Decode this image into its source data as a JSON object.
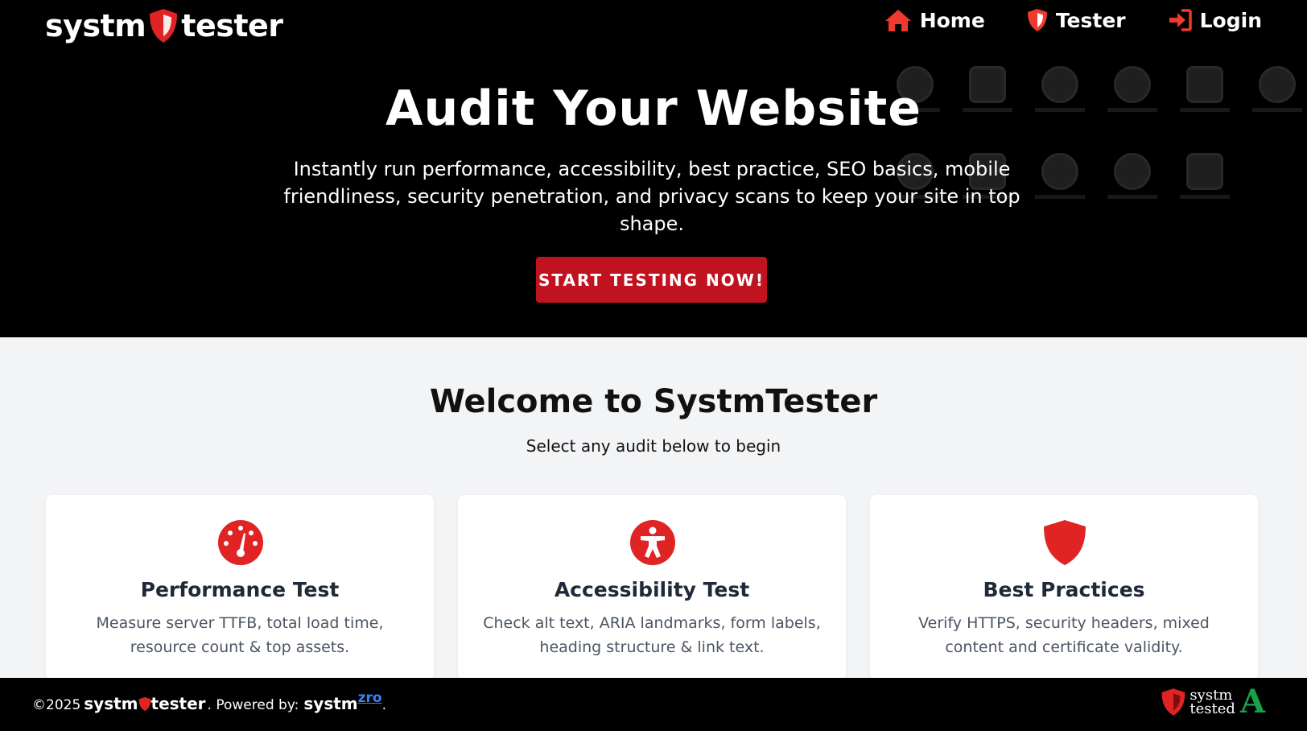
{
  "brand": {
    "word1": "systm",
    "word2": "tester",
    "accent": "#e02424"
  },
  "nav": [
    {
      "label": "Home",
      "icon": "home-icon"
    },
    {
      "label": "Tester",
      "icon": "shield-icon"
    },
    {
      "label": "Login",
      "icon": "login-icon"
    }
  ],
  "hero": {
    "title": "Audit Your Website",
    "subtitle": "Instantly run performance, accessibility, best practice, SEO basics, mobile friendliness, security penetration, and privacy scans to keep your site in top shape.",
    "cta": "START TESTING NOW!"
  },
  "welcome": {
    "title": "Welcome to SystmTester",
    "subtitle": "Select any audit below to begin"
  },
  "cards": [
    {
      "title": "Performance Test",
      "desc": "Measure server TTFB, total load time, resource count & top assets.",
      "icon": "gauge-icon"
    },
    {
      "title": "Accessibility Test",
      "desc": "Check alt text, ARIA landmarks, form labels, heading structure & link text.",
      "icon": "accessibility-icon"
    },
    {
      "title": "Best Practices",
      "desc": "Verify HTTPS, security headers, mixed content and certificate validity.",
      "icon": "shield-icon"
    }
  ],
  "footer": {
    "copyright": "©2025",
    "brand1": "systm",
    "brand2": "tester",
    "powered": ". Powered by:",
    "systm": "systm",
    "zro": "zro",
    "period": ".",
    "badge_line1": "systm",
    "badge_line2": "tested",
    "badge_grade": "A"
  },
  "colors": {
    "accent": "#c1121f",
    "hero_bg": "#000000",
    "page_bg": "#f3f4f6",
    "grade": "#16a34a",
    "link": "#3b82f6"
  }
}
